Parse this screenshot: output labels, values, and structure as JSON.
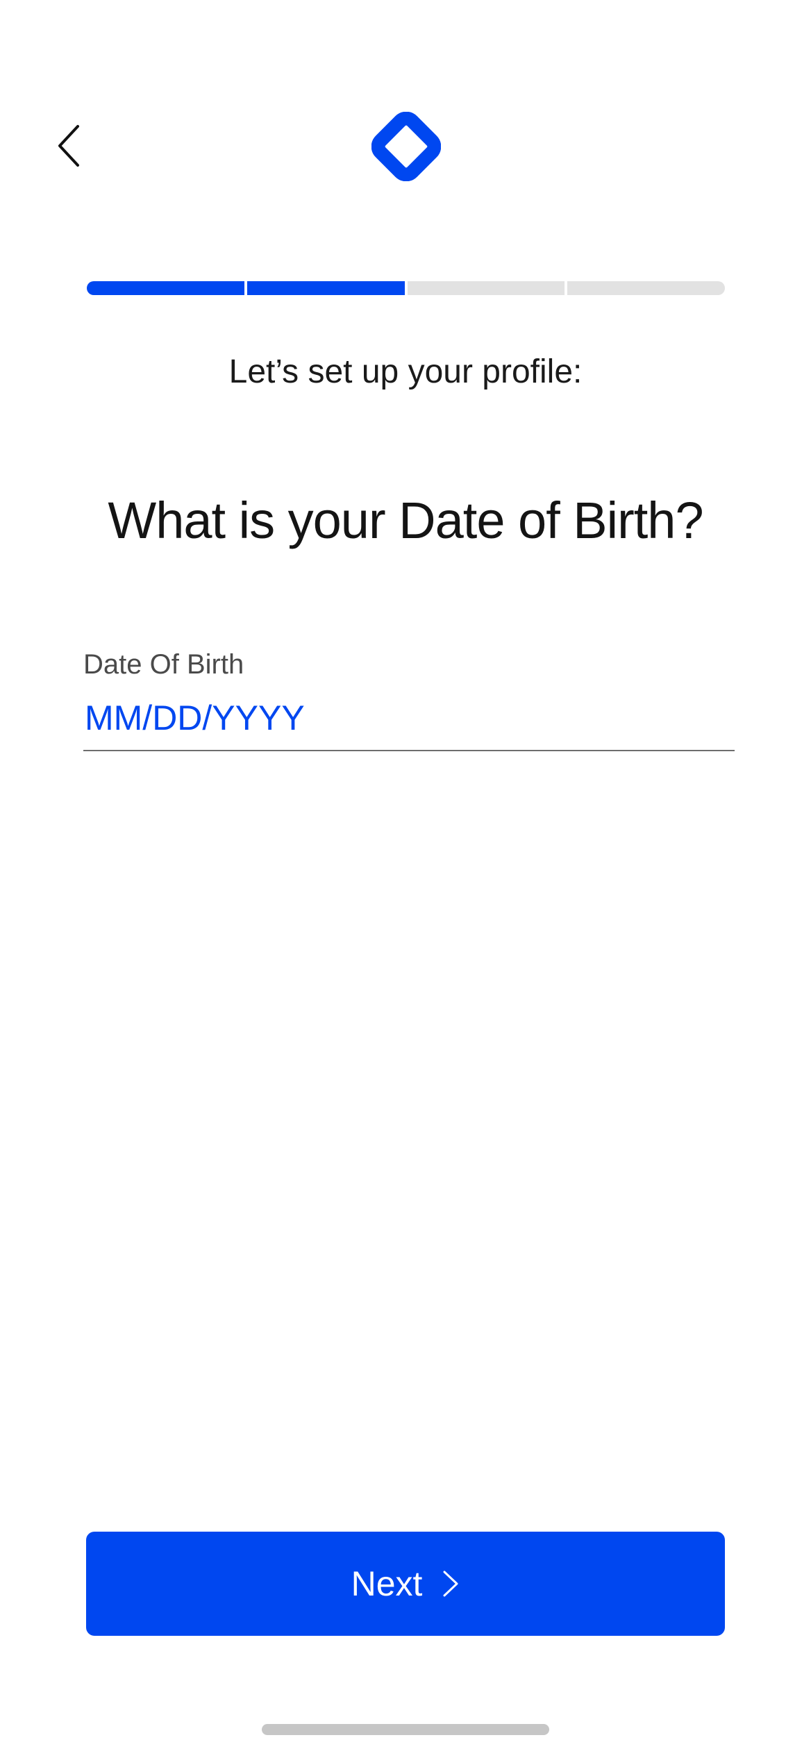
{
  "header": {
    "back_icon": "chevron-left-icon",
    "logo_icon": "diamond-logo-icon",
    "brand_color": "#0047f0"
  },
  "progress": {
    "total_steps": 4,
    "completed_steps": 2,
    "filled_color": "#0047f0",
    "empty_color": "#e2e2e2"
  },
  "content": {
    "subtitle": "Let’s set up your profile:",
    "heading": "What is your Date of Birth?"
  },
  "dob_field": {
    "label": "Date Of Birth",
    "value": "",
    "placeholder": "MM/DD/YYYY"
  },
  "footer": {
    "next_label": "Next",
    "next_icon": "chevron-right-icon"
  }
}
